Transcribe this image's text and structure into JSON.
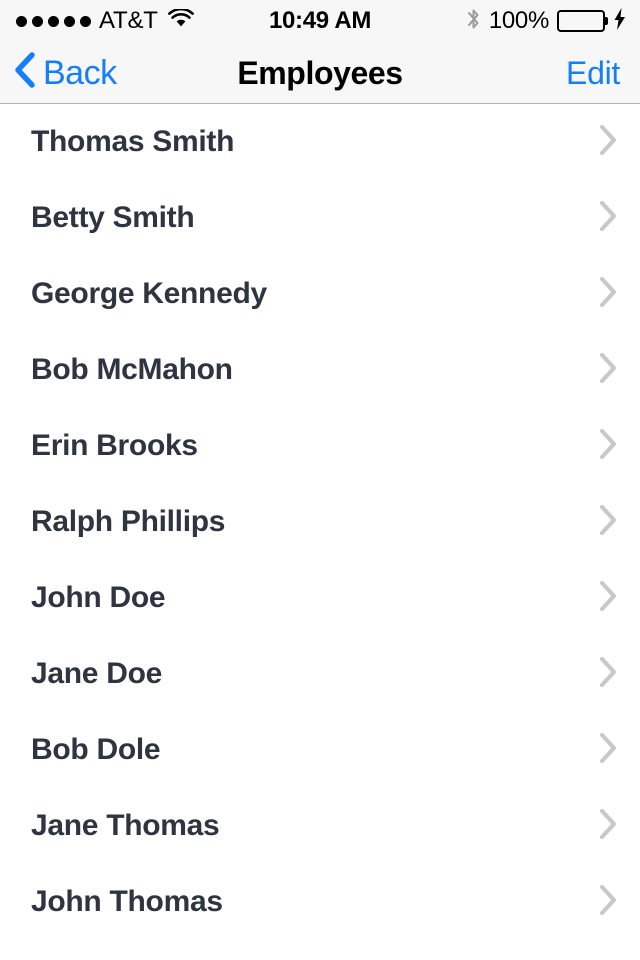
{
  "status_bar": {
    "signal_dots_filled": 5,
    "signal_dots_total": 5,
    "carrier": "AT&T",
    "wifi_icon": "wifi-icon",
    "time": "10:49 AM",
    "bluetooth_icon": "bluetooth-icon",
    "battery_percent": "100%",
    "battery_level": 100,
    "battery_color": "#4cd964",
    "charging_icon": "lightning-bolt-icon",
    "background": "#f7f7f7"
  },
  "nav_bar": {
    "back_label": "Back",
    "back_icon": "chevron-left-icon",
    "title": "Employees",
    "edit_label": "Edit",
    "accent_color": "#147efb",
    "background": "#f7f7f7"
  },
  "list": {
    "row_accessory_icon": "chevron-right-icon",
    "row_text_color": "#2e3440",
    "rows": [
      {
        "name": "Thomas Smith"
      },
      {
        "name": "Betty Smith"
      },
      {
        "name": "George Kennedy"
      },
      {
        "name": "Bob McMahon"
      },
      {
        "name": "Erin Brooks"
      },
      {
        "name": "Ralph Phillips"
      },
      {
        "name": "John Doe"
      },
      {
        "name": "Jane Doe"
      },
      {
        "name": "Bob Dole"
      },
      {
        "name": "Jane Thomas"
      },
      {
        "name": "John Thomas"
      }
    ]
  }
}
